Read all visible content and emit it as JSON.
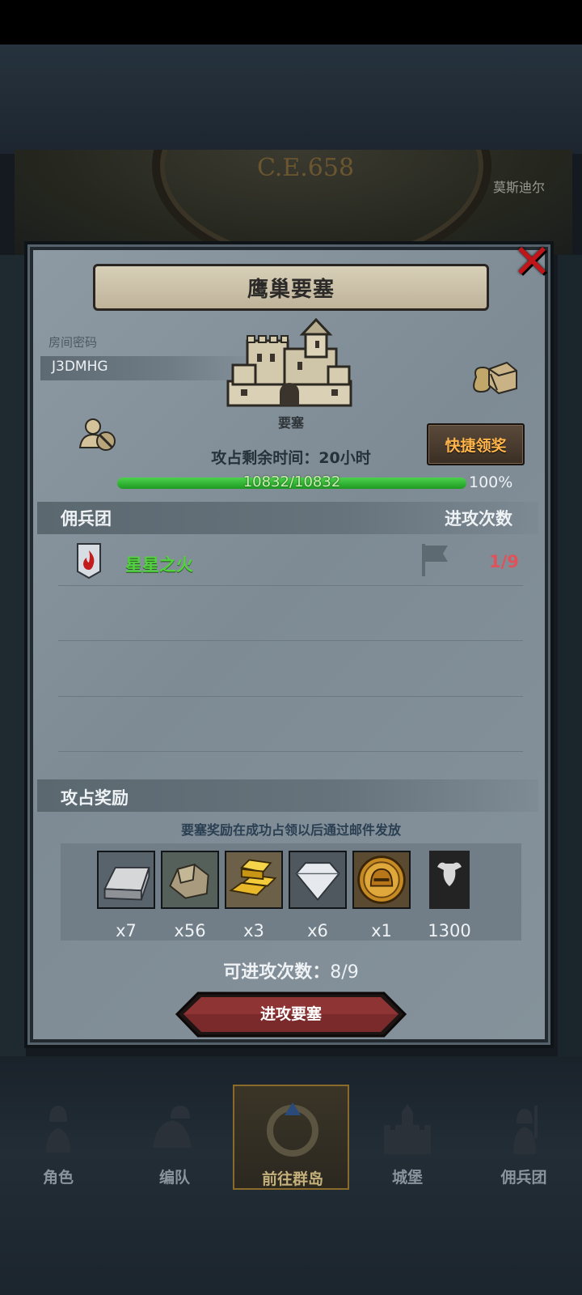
{
  "map": {
    "era_label": "C.E.658",
    "location_name": "莫斯迪尔"
  },
  "dialog": {
    "title": "鹰巢要塞",
    "room_label": "房间密码",
    "room_code": "J3DMHG",
    "fortress_label": "要塞",
    "claim_button": "快捷领奖",
    "time_remaining": "攻占剩余时间：20小时",
    "hp": {
      "current": 10832,
      "max": 10832,
      "text": "10832/10832",
      "percent_text": "100%",
      "fraction": 1.0
    },
    "mercenary_header": "佣兵团",
    "attack_count_header": "进攻次数",
    "guilds": [
      {
        "name": "星星之火",
        "count": "1/9"
      }
    ],
    "reward_header": "攻占奖励",
    "reward_note": "要塞奖励在成功占领以后通过邮件发放",
    "rewards": [
      {
        "item": "silver-ingot-icon",
        "qty": "x7"
      },
      {
        "item": "stone-ore-icon",
        "qty": "x56"
      },
      {
        "item": "gold-bars-icon",
        "qty": "x3"
      },
      {
        "item": "diamond-icon",
        "qty": "x6"
      },
      {
        "item": "helmet-coin-icon",
        "qty": "x1"
      },
      {
        "item": "bull-banner-icon",
        "qty": "1300"
      }
    ],
    "attempts_label": "可进攻次数：",
    "attempts_value": "8/9",
    "attack_button": "进攻要塞"
  },
  "bottom_nav": [
    {
      "label": "角色"
    },
    {
      "label": "编队"
    },
    {
      "label": "前往群岛"
    },
    {
      "label": "城堡"
    },
    {
      "label": "佣兵团"
    }
  ],
  "colors": {
    "guild_name": "#52d23e",
    "guild_count": "#e0525a",
    "claim_text": "#ffb54a",
    "close_x": "#c0161a",
    "hp_fill": "#2fb330"
  }
}
